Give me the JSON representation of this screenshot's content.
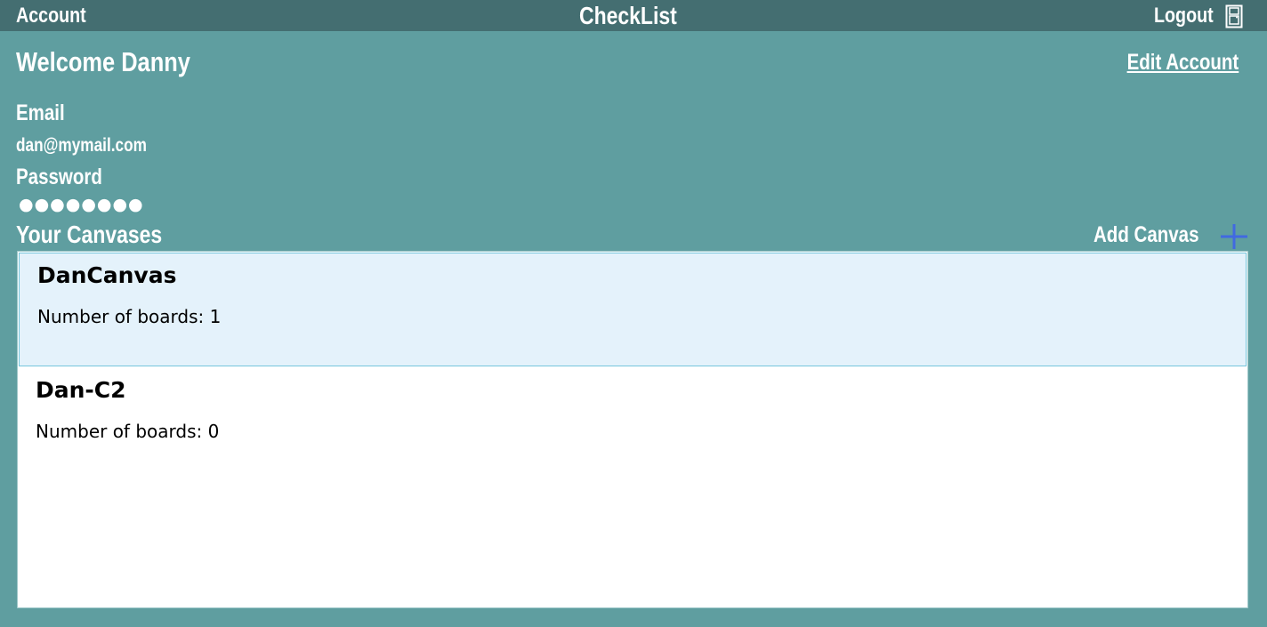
{
  "header": {
    "account_label": "Account",
    "title": "CheckList",
    "logout_label": "Logout",
    "logout_icon": "door-icon"
  },
  "account": {
    "welcome": "Welcome Danny",
    "edit_label": "Edit Account",
    "email_label": "Email",
    "email_value": "dan@mymail.com",
    "password_label": "Password",
    "password_value": "●●●●●●●●"
  },
  "canvases": {
    "title": "Your Canvases",
    "add_label": "Add Canvas",
    "add_icon": "plus-icon",
    "items": [
      {
        "name": "DanCanvas",
        "boards_text": "Number of boards: 1",
        "selected": true
      },
      {
        "name": "Dan-C2",
        "boards_text": "Number of boards: 0",
        "selected": false
      }
    ]
  },
  "colors": {
    "background": "#5f9ea0",
    "header": "#446e71",
    "accent_plus": "#4169e1",
    "selected_card": "#e4f2fb"
  }
}
